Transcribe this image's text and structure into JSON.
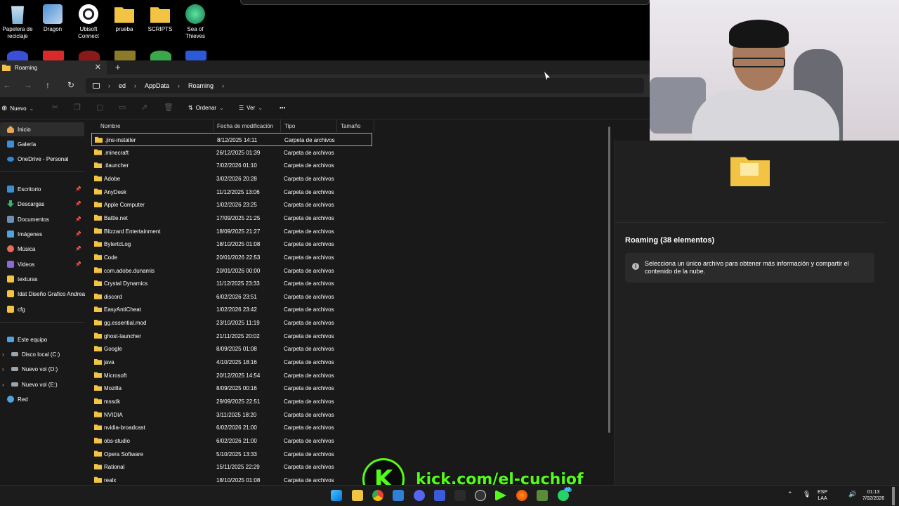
{
  "desktop": {
    "icons": [
      {
        "label": "Papelera de reciclaje",
        "icon": "recycle-bin-icon"
      },
      {
        "label": "Dragon",
        "icon": "dragon-app-icon"
      },
      {
        "label": "Ubisoft Connect",
        "icon": "ubisoft-icon"
      },
      {
        "label": "prueba",
        "icon": "folder-icon"
      },
      {
        "label": "SCRIPTS",
        "icon": "folder-icon"
      },
      {
        "label": "Sea of Thieves",
        "icon": "sea-of-thieves-icon"
      }
    ]
  },
  "explorer": {
    "tab_title": "Roaming",
    "new_tab": "+",
    "close": "✕",
    "breadcrumbs": [
      "ed",
      "AppData",
      "Roaming"
    ],
    "commands": {
      "new": "Nuevo",
      "sort": "Ordenar",
      "view": "Ver",
      "more": "•••"
    },
    "sidebar": {
      "top": [
        {
          "label": "Inicio",
          "icon": "home-icon",
          "color": "#e8a65a"
        },
        {
          "label": "Galería",
          "icon": "gallery-icon",
          "color": "#3a8fd8"
        },
        {
          "label": "OneDrive - Personal",
          "icon": "onedrive-icon",
          "color": "#2f86d6"
        }
      ],
      "pinned": [
        {
          "label": "Escritorio",
          "icon": "desktop-icon",
          "color": "#3a8fd8"
        },
        {
          "label": "Descargas",
          "icon": "download-icon",
          "color": "#3bb273"
        },
        {
          "label": "Documentos",
          "icon": "documents-icon",
          "color": "#6c8fb3"
        },
        {
          "label": "Imágenes",
          "icon": "pictures-icon",
          "color": "#4fa3e0"
        },
        {
          "label": "Música",
          "icon": "music-icon",
          "color": "#e86c5a"
        },
        {
          "label": "Videos",
          "icon": "videos-icon",
          "color": "#8a6ad8"
        },
        {
          "label": "texturas",
          "icon": "folder-icon",
          "color": "#f3c443"
        },
        {
          "label": "Idat Diseño Grafico Andrea",
          "icon": "folder-icon",
          "color": "#f3c443"
        },
        {
          "label": "cfg",
          "icon": "folder-icon",
          "color": "#f3c443"
        }
      ],
      "pc": [
        {
          "label": "Este equipo",
          "icon": "pc-icon",
          "color": "#4fa3e0"
        },
        {
          "label": "Disco local (C:)",
          "icon": "drive-icon",
          "color": "#9aa4ad"
        },
        {
          "label": "Nuevo vol (D:)",
          "icon": "drive-icon",
          "color": "#9aa4ad"
        },
        {
          "label": "Nuevo vol (E:)",
          "icon": "drive-icon",
          "color": "#9aa4ad"
        },
        {
          "label": "Red",
          "icon": "network-icon",
          "color": "#4fa3e0"
        }
      ]
    },
    "columns": [
      "Nombre",
      "Fecha de modificación",
      "Tipo",
      "Tamaño"
    ],
    "files": [
      {
        "name": ".jins-installer",
        "date": "8/12/2025 14:11",
        "type": "Carpeta de archivos"
      },
      {
        "name": ".minecraft",
        "date": "26/12/2025 01:39",
        "type": "Carpeta de archivos"
      },
      {
        "name": ".tlauncher",
        "date": "7/02/2026 01:10",
        "type": "Carpeta de archivos"
      },
      {
        "name": "Adobe",
        "date": "3/02/2026 20:28",
        "type": "Carpeta de archivos"
      },
      {
        "name": "AnyDesk",
        "date": "11/12/2025 13:06",
        "type": "Carpeta de archivos"
      },
      {
        "name": "Apple Computer",
        "date": "1/02/2026 23:25",
        "type": "Carpeta de archivos"
      },
      {
        "name": "Battle.net",
        "date": "17/09/2025 21:25",
        "type": "Carpeta de archivos"
      },
      {
        "name": "Blizzard Entertainment",
        "date": "18/09/2025 21:27",
        "type": "Carpeta de archivos"
      },
      {
        "name": "BytertcLog",
        "date": "18/10/2025 01:08",
        "type": "Carpeta de archivos"
      },
      {
        "name": "Code",
        "date": "20/01/2026 22:53",
        "type": "Carpeta de archivos"
      },
      {
        "name": "com.adobe.dunamis",
        "date": "20/01/2026 00:00",
        "type": "Carpeta de archivos"
      },
      {
        "name": "Crystal Dynamics",
        "date": "11/12/2025 23:33",
        "type": "Carpeta de archivos"
      },
      {
        "name": "discord",
        "date": "6/02/2026 23:51",
        "type": "Carpeta de archivos"
      },
      {
        "name": "EasyAntiCheat",
        "date": "1/02/2026 23:42",
        "type": "Carpeta de archivos"
      },
      {
        "name": "gg.essential.mod",
        "date": "23/10/2025 11:19",
        "type": "Carpeta de archivos"
      },
      {
        "name": "ghost-launcher",
        "date": "21/11/2025 20:02",
        "type": "Carpeta de archivos"
      },
      {
        "name": "Google",
        "date": "8/09/2025 01:08",
        "type": "Carpeta de archivos"
      },
      {
        "name": "java",
        "date": "4/10/2025 18:16",
        "type": "Carpeta de archivos"
      },
      {
        "name": "Microsoft",
        "date": "20/12/2025 14:54",
        "type": "Carpeta de archivos"
      },
      {
        "name": "Mozilla",
        "date": "8/09/2025 00:16",
        "type": "Carpeta de archivos"
      },
      {
        "name": "mssdk",
        "date": "29/09/2025 22:51",
        "type": "Carpeta de archivos"
      },
      {
        "name": "NVIDIA",
        "date": "3/11/2025 18:20",
        "type": "Carpeta de archivos"
      },
      {
        "name": "nvidia-broadcast",
        "date": "6/02/2026 21:00",
        "type": "Carpeta de archivos"
      },
      {
        "name": "obs-studio",
        "date": "6/02/2026 21:00",
        "type": "Carpeta de archivos"
      },
      {
        "name": "Opera Software",
        "date": "5/10/2025 13:33",
        "type": "Carpeta de archivos"
      },
      {
        "name": "Rational",
        "date": "15/11/2025 22:29",
        "type": "Carpeta de archivos"
      },
      {
        "name": "realx",
        "date": "18/10/2025 01:08",
        "type": "Carpeta de archivos"
      }
    ],
    "details": {
      "title": "Roaming (38 elementos)",
      "info": "Selecciona un único archivo para obtener más información y compartir el contenido de la nube."
    }
  },
  "overlay": {
    "kick_logo": "K",
    "kick_url": "kick.com/el-cuchiof"
  },
  "taskbar": {
    "lang": "ESP",
    "lang2": "LAA",
    "time": "01:13",
    "date": "7/02/2026",
    "badge": "27"
  },
  "colors": {
    "folder": "#f3c443",
    "kick_green": "#53fc18"
  }
}
